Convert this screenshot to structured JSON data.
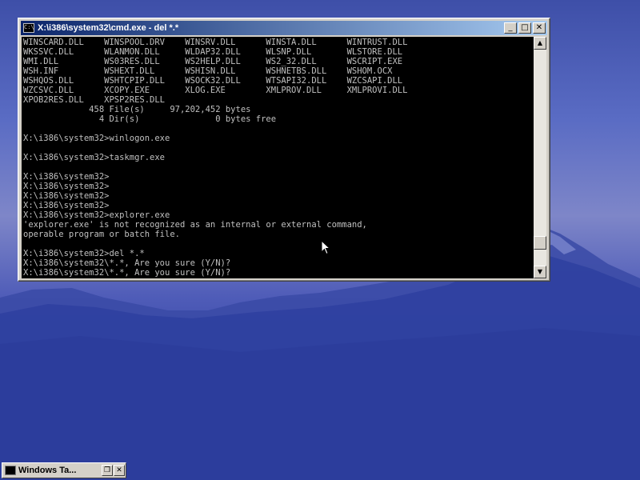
{
  "window": {
    "title": "X:\\i386\\system32\\cmd.exe - del *.*",
    "minimize_glyph": "_",
    "maximize_glyph": "□",
    "close_glyph": "✕",
    "titlebar_color_left": "#0a246a",
    "titlebar_color_right": "#a6caf0"
  },
  "console": {
    "background": "#000000",
    "foreground": "#c0c0c0",
    "lines": [
      "WINSCARD.DLL    WINSPOOL.DRV    WINSRV.DLL      WINSTA.DLL      WINTRUST.DLL",
      "WKSSVC.DLL      WLANMON.DLL     WLDAP32.DLL     WLSNP.DLL       WLSTORE.DLL",
      "WMI.DLL         WS03RES.DLL     WS2HELP.DLL     WS2_32.DLL      WSCRIPT.EXE",
      "WSH.INF         WSHEXT.DLL      WSHISN.DLL      WSHNETBS.DLL    WSHOM.OCX",
      "WSHQOS.DLL      WSHTCPIP.DLL    WSOCK32.DLL     WTSAPI32.DLL    WZCSAPI.DLL",
      "WZCSVC.DLL      XCOPY.EXE       XLOG.EXE        XMLPROV.DLL     XMLPROVI.DLL",
      "XPOB2RES.DLL    XPSP2RES.DLL",
      "             458 File(s)     97,202,452 bytes",
      "               4 Dir(s)               0 bytes free",
      "",
      "X:\\i386\\system32>winlogon.exe",
      "",
      "X:\\i386\\system32>taskmgr.exe",
      "",
      "X:\\i386\\system32>",
      "X:\\i386\\system32>",
      "X:\\i386\\system32>",
      "X:\\i386\\system32>",
      "X:\\i386\\system32>explorer.exe",
      "'explorer.exe' is not recognized as an internal or external command,",
      "operable program or batch file.",
      "",
      "X:\\i386\\system32>del *.*",
      "X:\\i386\\system32\\*.*, Are you sure (Y/N)?",
      "X:\\i386\\system32\\*.*, Are you sure (Y/N)?"
    ]
  },
  "scrollbar": {
    "up_glyph": "▲",
    "down_glyph": "▼",
    "position_fraction": 0.92
  },
  "taskbar": {
    "button_label": "Windows Ta...",
    "restore_glyph": "❐",
    "close_glyph": "✕"
  }
}
